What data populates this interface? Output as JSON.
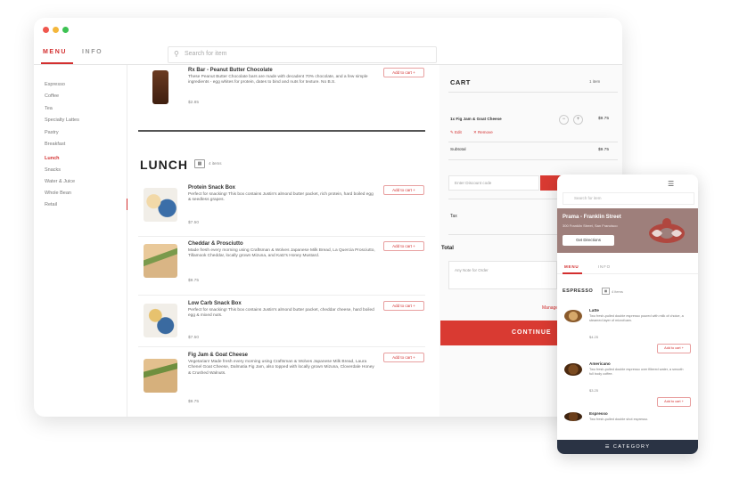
{
  "nav": {
    "tabs": [
      "MENU",
      "INFO"
    ],
    "search_placeholder": "Search for item"
  },
  "sidebar": {
    "items": [
      "Espresso",
      "Coffee",
      "Tea",
      "Specialty Lattes",
      "Pastry",
      "Breakfast",
      "Lunch",
      "Snacks",
      "Water & Juice",
      "Whole Bean",
      "Retail"
    ]
  },
  "main": {
    "top_item": {
      "name": "Rx Bar - Peanut Butter Chocolate",
      "desc": "These Peanut Butter Chocolate bars are made with decadent 70% chocolate, and a few simple ingredients - egg whites for protein, dates to bind and nuts for texture. No B.S.",
      "price": "$2.85",
      "add": "Add to cart +"
    },
    "section": {
      "title": "LUNCH",
      "count": "4 items"
    },
    "items": [
      {
        "name": "Protein Snack Box",
        "desc": "Perfect for snacking! This box contains Justin's almond butter packet, rich protein, hard boiled egg & seedless grapes.",
        "price": "$7.50",
        "add": "Add to cart +"
      },
      {
        "name": "Cheddar & Prosciutto",
        "desc": "Made fresh every morning using Craftsman & Wolves Japanese Milk Bread, La Quercia Prosciutto, Tillamook Cheddar, locally grown Mizuna, and Katz's Honey Mustard.",
        "price": "$9.75",
        "add": "Add to cart +"
      },
      {
        "name": "Low Carb Snack Box",
        "desc": "Perfect for snacking! This box contains Justin's almond butter packet, cheddar cheese, hard boiled egg & mixed nuts.",
        "price": "$7.50",
        "add": "Add to cart +"
      },
      {
        "name": "Fig Jam & Goat Cheese",
        "desc": "Vegetarian! Made fresh every morning using Craftsman & Wolves Japanese Milk Bread, Laura Chenel Goat Cheese, Dalmatia Fig Jam, also topped with locally grown Mizuna, Cloverdale Honey & Crushed Walnuts.",
        "price": "$9.75",
        "add": "Add to cart +"
      }
    ]
  },
  "cart": {
    "title": "CART",
    "count": "1 item",
    "item": {
      "name": "1x Fig Jam & Goat Cheese",
      "price": "$9.75",
      "edit": "Edit",
      "remove": "Remove"
    },
    "subtotal_label": "Subtotal",
    "subtotal": "$9.75",
    "discount_placeholder": "Enter Discount code",
    "discount_button": "Apply Discount",
    "tax_label": "Tax",
    "total_label": "Total",
    "note_placeholder": "Any Note for Order",
    "manage": "Manage Wallet",
    "continue": "CONTINUE"
  },
  "phone": {
    "search_placeholder": "Search for item",
    "store": "Prama - Franklin Street",
    "address": "300 Franklin Street, San Francisco",
    "directions": "Get Directions",
    "tabs": [
      "MENU",
      "INFO"
    ],
    "section": "ESPRESSO",
    "section_count": "4 items",
    "items": [
      {
        "name": "Latte",
        "desc": "Two fresh-pulled double espresso poured with milk of choice, a steamed layer of microfoam.",
        "price": "$4.25",
        "add": "Add to cart +"
      },
      {
        "name": "Americano",
        "desc": "Two fresh-pulled double espresso over filtered water, a smooth full body coffee.",
        "price": "$3.25",
        "add": "Add to cart +"
      },
      {
        "name": "Espresso",
        "desc": "Two fresh-pulled double shot espresso.",
        "price": "",
        "add": ""
      }
    ],
    "category_bar": "CATEGORY"
  },
  "colors": {
    "accent": "#d93a32",
    "category_bar": "#2a3344",
    "hero": "#9e7f7b"
  }
}
